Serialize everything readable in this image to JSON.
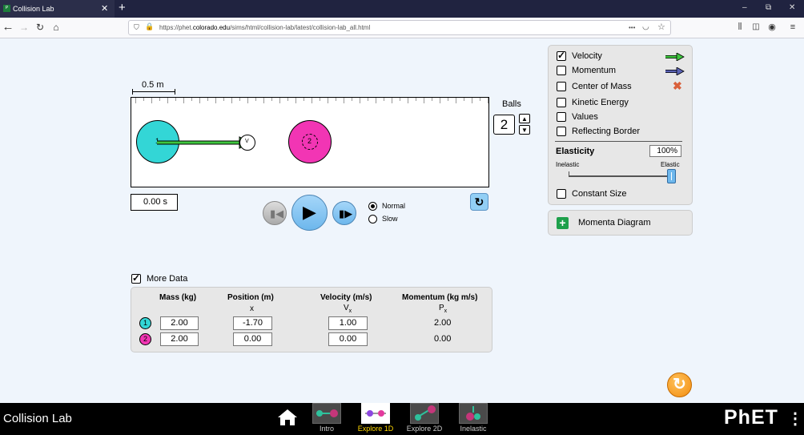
{
  "browser": {
    "tab_title": "Collision Lab",
    "url_prefix": "https://phet.",
    "url_domain": "colorado.edu",
    "url_path": "/sims/html/collision-lab/latest/collision-lab_all.html",
    "url_more": "•••"
  },
  "sim": {
    "scale_label": "0.5 m",
    "time": "0.00 s",
    "balls_label": "Balls",
    "balls_count": "2",
    "ball1_number": "1",
    "ball2_number": "2",
    "velocity_arrow_label": "V",
    "speed_normal": "Normal",
    "speed_slow": "Slow"
  },
  "checkboxes": {
    "velocity": "Velocity",
    "momentum": "Momentum",
    "center_of_mass": "Center of Mass",
    "kinetic_energy": "Kinetic Energy",
    "values": "Values",
    "reflecting_border": "Reflecting Border",
    "constant_size": "Constant Size"
  },
  "elasticity": {
    "title": "Elasticity",
    "value": "100%",
    "min_label": "Inelastic",
    "max_label": "Elastic",
    "level_fraction": 1.0
  },
  "momenta_diagram": "Momenta Diagram",
  "more_data": {
    "label": "More Data",
    "headers": [
      "Mass (kg)",
      "Position (m)",
      "Velocity (m/s)",
      "Momentum (kg m/s)"
    ],
    "subheaders": [
      "",
      "x",
      "V",
      "P"
    ],
    "subheader_subscripts": [
      "",
      "",
      "x",
      "x"
    ],
    "rows": [
      {
        "ball": "1",
        "mass": "2.00",
        "position": "-1.70",
        "velocity": "1.00",
        "momentum": "2.00"
      },
      {
        "ball": "2",
        "mass": "2.00",
        "position": "0.00",
        "velocity": "0.00",
        "momentum": "0.00"
      }
    ]
  },
  "bottom": {
    "app_title": "Collision Lab",
    "screens": [
      "Intro",
      "Explore 1D",
      "Explore 2D",
      "Inelastic"
    ],
    "selected_screen": "Explore 1D",
    "logo": "PhET"
  },
  "colors": {
    "ball1": "#33d6d6",
    "ball2": "#f235b4",
    "velocity_arrow": "#3ec63e",
    "momentum_arrow": "#5b63b6",
    "selected_screen": "#ffd700"
  }
}
